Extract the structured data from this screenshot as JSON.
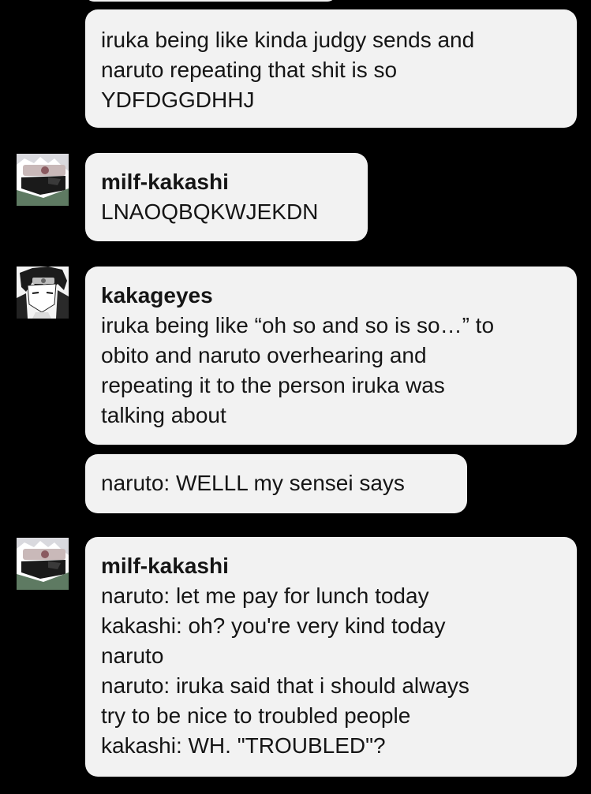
{
  "messages": [
    {
      "sender": "",
      "lines": [
        "iruka being like kinda judgy sends and",
        "naruto repeating that shit is so",
        "YDFDGGDHHJ"
      ]
    },
    {
      "sender": "milf-kakashi",
      "lines": [
        "LNAOQBQKWJEKDN"
      ]
    },
    {
      "sender": "kakageyes",
      "lines": [
        "iruka being like “oh so and so is so…” to",
        "obito and naruto overhearing and",
        "repeating it to the person iruka was",
        "talking about"
      ]
    },
    {
      "sender": "",
      "lines": [
        "naruto: WELLL my sensei says"
      ]
    },
    {
      "sender": "milf-kakashi",
      "lines": [
        "naruto: let me pay for lunch today",
        "kakashi: oh? you're very kind today",
        "naruto",
        "naruto: iruka said that i should always",
        "try to be nice to troubled people",
        "kakashi: WH. \"TROUBLED\"?"
      ]
    }
  ],
  "colors": {
    "background": "#000000",
    "bubble": "#f2f2f2",
    "text": "#151515"
  },
  "avatars": {
    "milf_kakashi": "kakashi-avatar-icon",
    "kakageyes": "sasuke-avatar-icon"
  }
}
